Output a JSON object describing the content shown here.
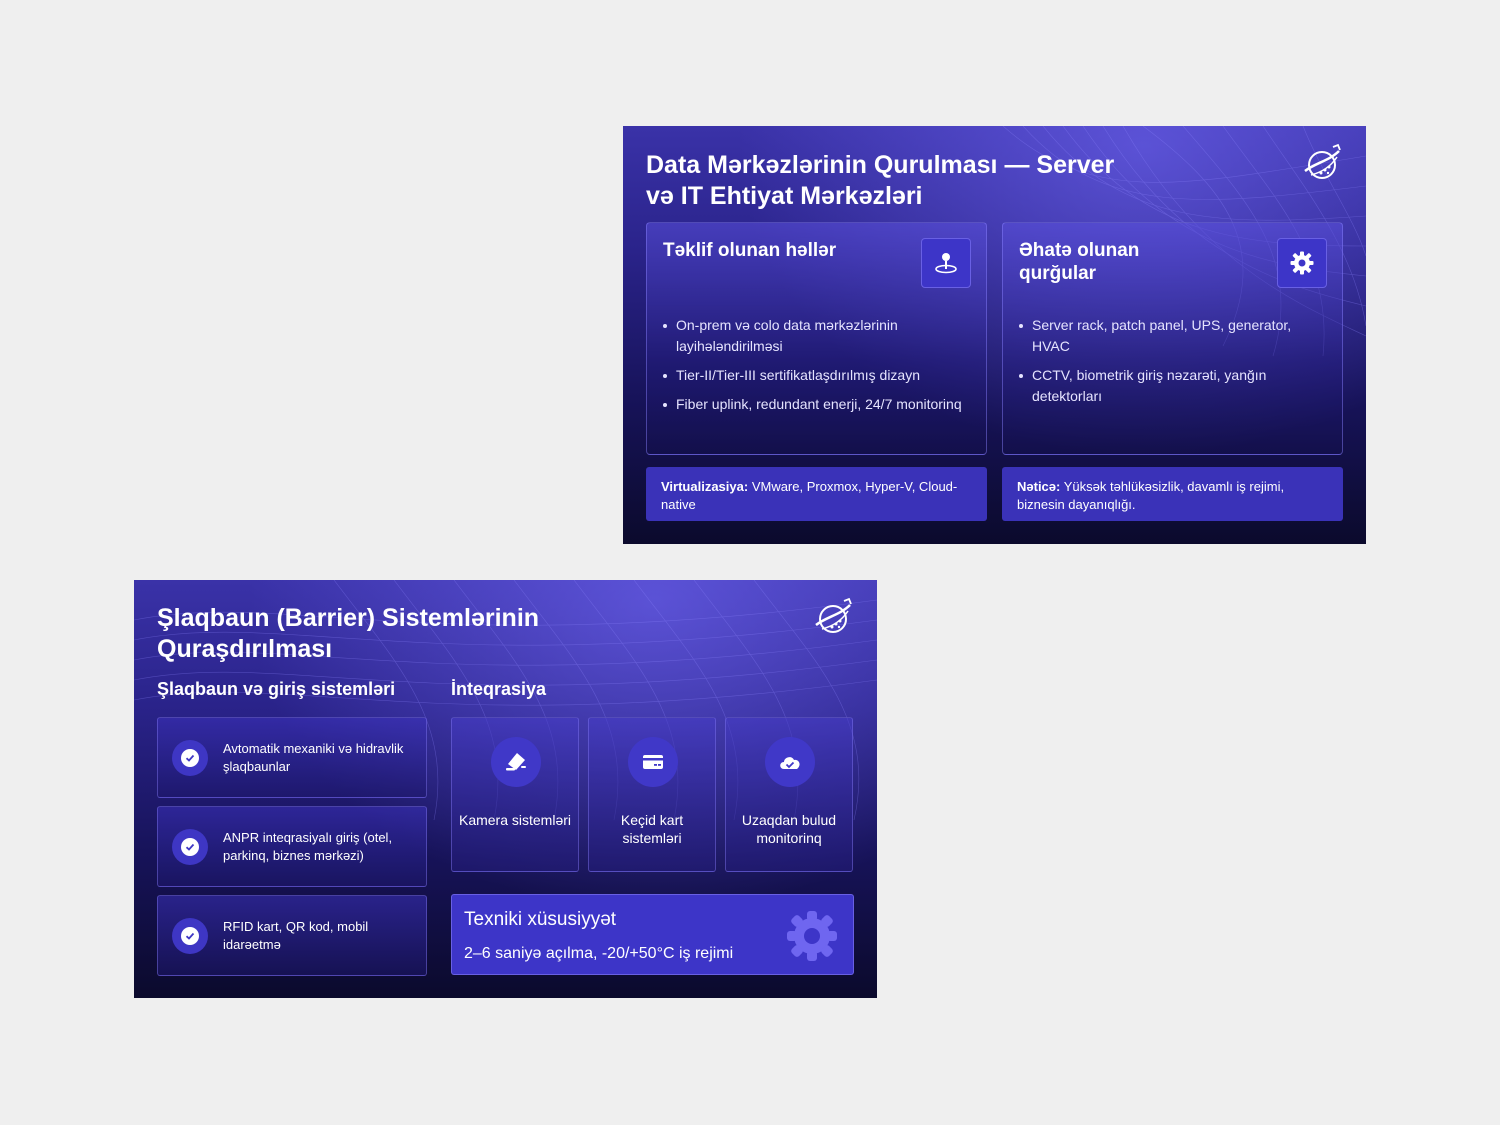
{
  "slide1": {
    "title_line1": "Data Mərkəzlərinin Qurulması — Server",
    "title_line2": "və IT Ehtiyat Mərkəzləri",
    "logo_icon": "globe-satellite-logo-icon",
    "cards": [
      {
        "title": "Təklif olunan həllər",
        "icon": "location-pin-icon",
        "items": [
          "On-prem və colo data mərkəzlərinin layihələndirilməsi",
          "Tier-II/Tier-III sertifikatlaşdırılmış dizayn",
          "Fiber uplink, redundant enerji, 24/7 monitorinq"
        ]
      },
      {
        "title": "Əhatə olunan qurğular",
        "icon": "gear-icon",
        "items": [
          "Server rack, patch panel, UPS, generator, HVAC",
          "CCTV, biometrik giriş nəzarəti, yanğın detektorları"
        ]
      }
    ],
    "notes": [
      {
        "label": "Virtualizasiya:",
        "text": " VMware, Proxmox, Hyper-V, Cloud-native"
      },
      {
        "label": "Nəticə:",
        "text": " Yüksək təhlükəsizlik, davamlı iş rejimi, biznesin dayanıqlığı."
      }
    ]
  },
  "slide2": {
    "title_line1": "Şlaqbaun (Barrier) Sistemlərinin",
    "title_line2": "Quraşdırılması",
    "logo_icon": "globe-satellite-logo-icon",
    "left_heading": "Şlaqbaun və giriş sistemləri",
    "right_heading": "İnteqrasiya",
    "checklist": [
      "Avtomatik mexaniki və hidravlik şlaqbaunlar",
      "ANPR inteqrasiyalı giriş (otel, parkinq, biznes mərkəzi)",
      "RFID kart, QR kod, mobil idarəetmə"
    ],
    "integrations": [
      {
        "label": "Kamera sistemləri",
        "icon": "camera-icon"
      },
      {
        "label": "Keçid kart sistemləri",
        "icon": "card-icon"
      },
      {
        "label": "Uzaqdan bulud monitorinq",
        "icon": "cloud-check-icon"
      }
    ],
    "tech": {
      "title": "Texniki xüsusiyyət",
      "subtitle": "2–6 saniyə açılma, -20/+50°C iş rejimi",
      "icon": "gear-icon"
    }
  },
  "colors": {
    "page_bg": "#efefef",
    "slide_top": "#3a32a8",
    "slide_bottom": "#0b0a2c",
    "accent": "#3d35c8"
  }
}
